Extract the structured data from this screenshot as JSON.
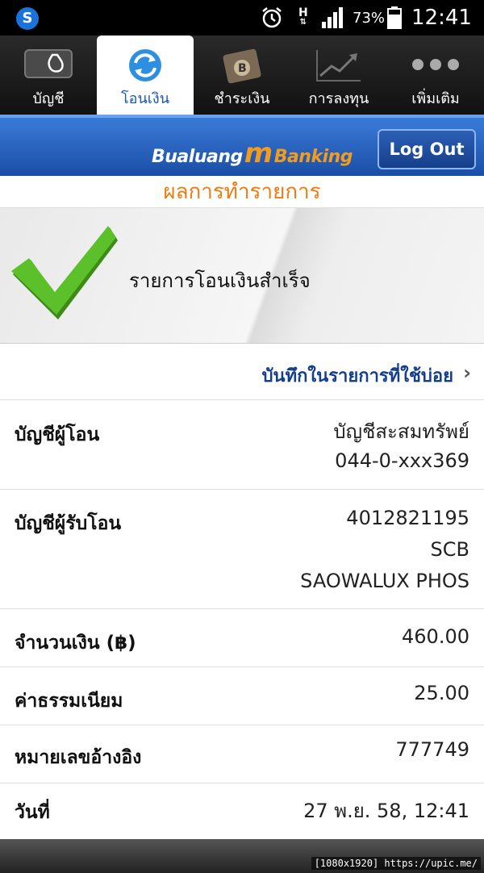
{
  "status_bar": {
    "network": "H",
    "battery_percent": "73%",
    "time": "12:41"
  },
  "tabs": [
    {
      "label": "บัญชี",
      "active": false
    },
    {
      "label": "โอนเงิน",
      "active": true
    },
    {
      "label": "ชำระเงิน",
      "active": false
    },
    {
      "label": "การลงทุน",
      "active": false
    },
    {
      "label": "เพิ่มเติม",
      "active": false
    }
  ],
  "header": {
    "brand_left": "Bualuang",
    "brand_mid": "m",
    "brand_right": "Banking",
    "logout_label": "Log Out"
  },
  "page_title": "ผลการทำรายการ",
  "success_message": "รายการโอนเงินสำเร็จ",
  "favorite_link": "บันทึกในรายการที่ใช้บ่อย",
  "details": {
    "from_label": "บัญชีผู้โอน",
    "from_lines": [
      "บัญชีสะสมทรัพย์",
      "044-0-xxx369"
    ],
    "to_label": "บัญชีผู้รับโอน",
    "to_lines": [
      "4012821195",
      "SCB",
      "SAOWALUX PHOS"
    ],
    "amount_label": "จำนวนเงิน (฿)",
    "amount_value": "460.00",
    "fee_label": "ค่าธรรมเนียม",
    "fee_value": "25.00",
    "ref_label": "หมายเลขอ้างอิง",
    "ref_value": "777749",
    "date_label": "วันที่",
    "date_value": "27 พ.ย. 58, 12:41"
  },
  "watermark": "[1080x1920] https://upic.me/",
  "colors": {
    "accent_orange": "#ef7b10",
    "link_blue": "#123e8c",
    "header_blue": "#1a4ea6",
    "check_green": "#5cc02a"
  },
  "icons": {
    "tab_account": "wallet-icon",
    "tab_transfer": "refresh-arrows-icon",
    "tab_payment": "bill-icon",
    "tab_investment": "chart-icon",
    "tab_more": "more-dots-icon"
  }
}
